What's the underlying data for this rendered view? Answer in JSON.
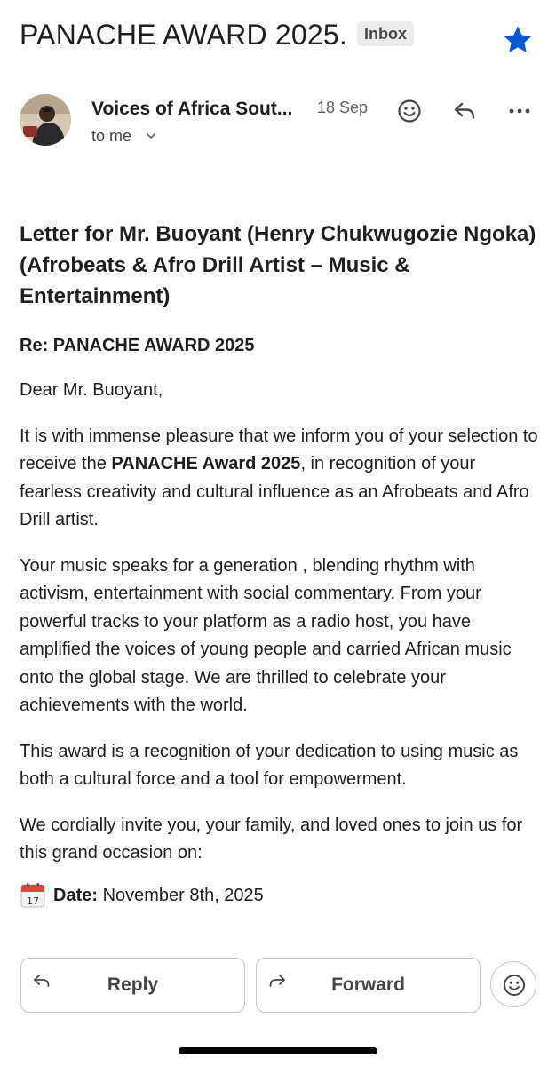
{
  "header": {
    "subject": "PANACHE AWARD 2025.",
    "label_badge": "Inbox",
    "star_icon": "star-filled-icon",
    "accent_color": "#0b57d0"
  },
  "sender": {
    "name": "Voices of Africa Sout...",
    "date": "18 Sep",
    "recipient": "to me",
    "icons": [
      "emoji-react-icon",
      "reply-icon",
      "more-horizontal-icon"
    ]
  },
  "message": {
    "title": "Letter for Mr. Buoyant (Henry Chukwugozie Ngoka) (Afrobeats & Afro Drill Artist – Music & Entertainment)",
    "re": "Re: PANACHE AWARD 2025",
    "greeting": "Dear Mr. Buoyant,",
    "p1_before": "It is with immense pleasure that we inform you of your selection to receive the ",
    "p1_bold": "PANACHE Award 2025",
    "p1_after": ", in recognition of your fearless creativity and cultural influence as an Afrobeats and Afro Drill artist.",
    "p2": "Your music speaks for a generation , blending rhythm with activism, entertainment with social commentary. From your powerful tracks to your platform as a radio host, you have amplified the voices of young people and carried African music onto the global stage. We are thrilled to celebrate your achievements with the world.",
    "p3": "This award is a recognition of your dedication to using music as both a cultural force and a tool for empowerment.",
    "p4": "We cordially invite you, your family, and loved ones to join us for this grand occasion on:",
    "date_label": "Date:",
    "date_value": " November 8th, 2025",
    "calendar_icon": "calendar-icon"
  },
  "actions": {
    "reply_label": "Reply",
    "forward_label": "Forward",
    "emoji_icon": "emoji-react-icon"
  }
}
